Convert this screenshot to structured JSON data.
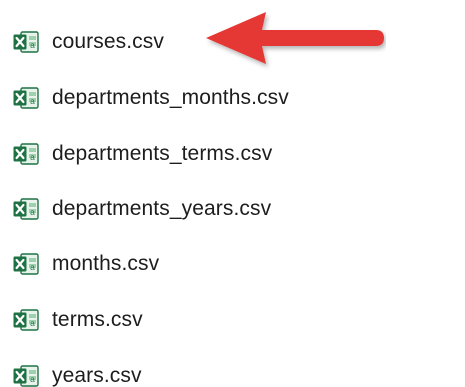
{
  "files": [
    {
      "name": "courses.csv",
      "icon": "excel-csv-icon"
    },
    {
      "name": "departments_months.csv",
      "icon": "excel-csv-icon"
    },
    {
      "name": "departments_terms.csv",
      "icon": "excel-csv-icon"
    },
    {
      "name": "departments_years.csv",
      "icon": "excel-csv-icon"
    },
    {
      "name": "months.csv",
      "icon": "excel-csv-icon"
    },
    {
      "name": "terms.csv",
      "icon": "excel-csv-icon"
    },
    {
      "name": "years.csv",
      "icon": "excel-csv-icon"
    }
  ],
  "annotation": {
    "arrow_icon": "red-arrow-icon",
    "arrow_color": "#e53935",
    "points_to": "courses.csv"
  },
  "colors": {
    "excel_green": "#1f7244",
    "excel_light": "#cfe8d6",
    "text": "#1d1d1d"
  }
}
